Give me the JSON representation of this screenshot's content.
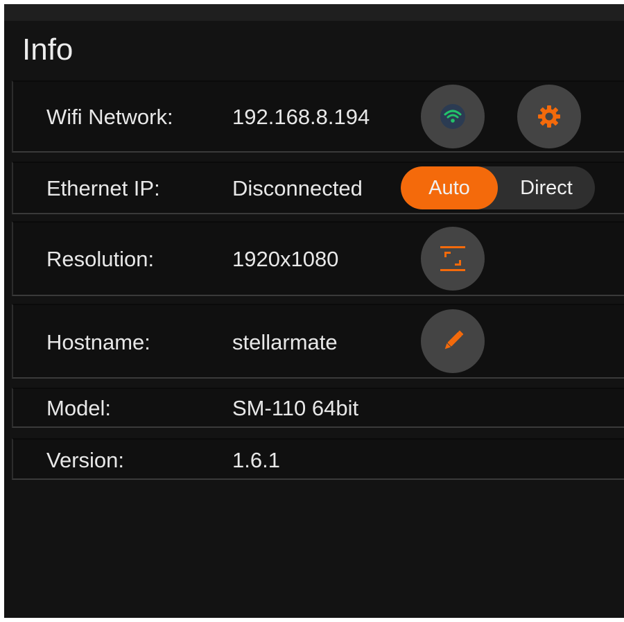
{
  "title": "Info",
  "colors": {
    "accent": "#f46a0b",
    "wifi_green": "#23c26a",
    "background": "#131313"
  },
  "rows": {
    "wifi": {
      "label": "Wifi Network:",
      "value": "192.168.8.194",
      "icons": [
        "wifi-icon",
        "gear-icon"
      ]
    },
    "ethernet": {
      "label": "Ethernet IP:",
      "value": "Disconnected",
      "toggle": {
        "options": [
          "Auto",
          "Direct"
        ],
        "selected": "Auto"
      }
    },
    "resolution": {
      "label": "Resolution:",
      "value": "1920x1080",
      "icons": [
        "resolution-icon"
      ]
    },
    "hostname": {
      "label": "Hostname:",
      "value": "stellarmate",
      "icons": [
        "pencil-icon"
      ]
    },
    "model": {
      "label": "Model:",
      "value": "SM-110 64bit"
    },
    "version": {
      "label": "Version:",
      "value": "1.6.1"
    }
  }
}
